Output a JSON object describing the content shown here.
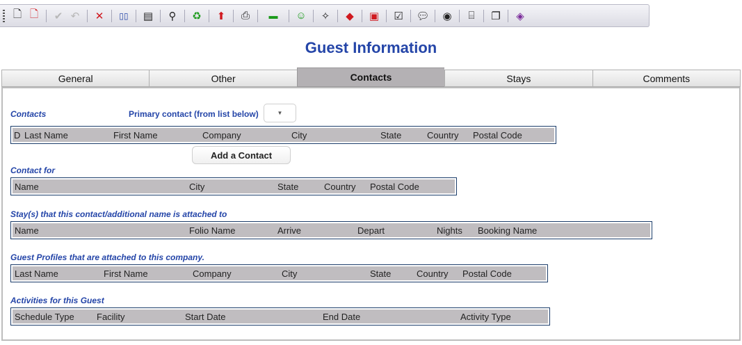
{
  "toolbar": {
    "icons": [
      "new-document",
      "new-document-alt",
      "check",
      "undo",
      "delete",
      "compare",
      "note",
      "find-add",
      "refresh-money",
      "upload",
      "printer",
      "money",
      "smiley",
      "magic-wand",
      "tag",
      "bag",
      "checklist",
      "speech",
      "camera",
      "scroll",
      "copy",
      "book"
    ]
  },
  "page": {
    "title": "Guest Information"
  },
  "tabs": [
    {
      "label": "General"
    },
    {
      "label": "Other"
    },
    {
      "label": "Contacts"
    },
    {
      "label": "Stays"
    },
    {
      "label": "Comments"
    }
  ],
  "contacts": {
    "section_label": "Contacts",
    "primary_label": "Primary contact (from list below)",
    "dropdown_value": "",
    "columns": [
      "D",
      "Last Name",
      "First Name",
      "Company",
      "City",
      "State",
      "Country",
      "Postal Code"
    ],
    "add_button": "Add a Contact"
  },
  "contact_for": {
    "section_label": "Contact for",
    "columns": [
      "Name",
      "City",
      "State",
      "Country",
      "Postal Code"
    ]
  },
  "stays": {
    "section_label": "Stay(s) that this contact/additional name is attached to",
    "columns": [
      "Name",
      "Folio Name",
      "Arrive",
      "Depart",
      "Nights",
      "Booking Name"
    ]
  },
  "profiles": {
    "section_label": "Guest Profiles that are attached to this company.",
    "columns": [
      "Last Name",
      "First Name",
      "Company",
      "City",
      "State",
      "Country",
      "Postal Code"
    ]
  },
  "activities": {
    "section_label": "Activities for this Guest",
    "columns": [
      "Schedule Type",
      "Facility",
      "Start Date",
      "End Date",
      "Activity Type"
    ]
  },
  "colors": {
    "title": "#2445a8",
    "grid_header": "#c0bdc0",
    "active_tab": "#b4b1b4"
  }
}
